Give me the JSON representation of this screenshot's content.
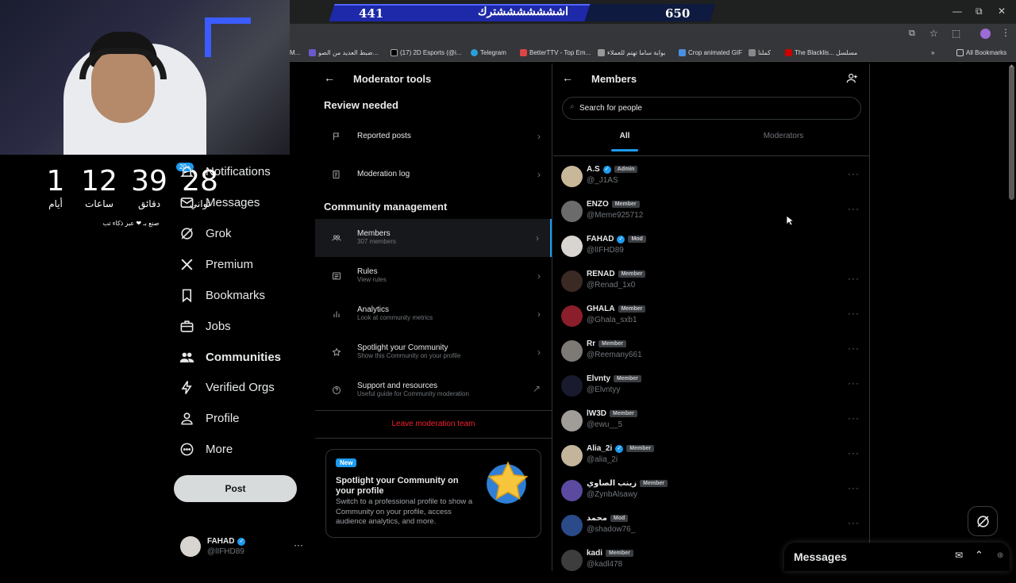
{
  "stream": {
    "ticker_left": "441",
    "ticker_text": "اشششششششترك",
    "ticker_right": "650",
    "countdown": [
      {
        "value": "1",
        "label": "أيام"
      },
      {
        "value": "12",
        "label": "ساعات"
      },
      {
        "value": "39",
        "label": "دقائق"
      },
      {
        "value": "28",
        "label": "ثواني"
      }
    ],
    "countdown_sub": "صنع بـ ❤ عبر ذكاء تب"
  },
  "bookmarks": [
    "M...",
    "ضبط العديد من الصو...",
    "(17) 2D Esports (@i...",
    "Telegram",
    "BetterTTV - Top Em...",
    "بوابة ساما تهتم للعملاء",
    "Crop animated GIF",
    "كملنا",
    "The Blacklis... مسلسل",
    "All Bookmarks"
  ],
  "nav": {
    "badge": "20+",
    "items": [
      {
        "label": "Notifications",
        "icon": "bell-icon"
      },
      {
        "label": "Messages",
        "icon": "envelope-icon"
      },
      {
        "label": "Grok",
        "icon": "grok-icon"
      },
      {
        "label": "Premium",
        "icon": "x-logo-icon"
      },
      {
        "label": "Bookmarks",
        "icon": "bookmark-icon"
      },
      {
        "label": "Jobs",
        "icon": "briefcase-icon"
      },
      {
        "label": "Communities",
        "icon": "people-icon"
      },
      {
        "label": "Verified Orgs",
        "icon": "lightning-icon"
      },
      {
        "label": "Profile",
        "icon": "person-icon"
      },
      {
        "label": "More",
        "icon": "more-circle-icon"
      }
    ],
    "post_label": "Post",
    "profile_name": "FAHAD",
    "profile_handle": "@lIFHD89"
  },
  "moderator": {
    "title": "Moderator tools",
    "review_heading": "Review needed",
    "review_items": [
      {
        "title": "Reported posts",
        "sub": ""
      },
      {
        "title": "Moderation log",
        "sub": ""
      }
    ],
    "management_heading": "Community management",
    "management_items": [
      {
        "title": "Members",
        "sub": "307 members"
      },
      {
        "title": "Rules",
        "sub": "View rules"
      },
      {
        "title": "Analytics",
        "sub": "Look at community metrics"
      },
      {
        "title": "Spotlight your Community",
        "sub": "Show this Community on your profile"
      },
      {
        "title": "Support and resources",
        "sub": "Useful guide for Community moderation"
      }
    ],
    "leave_label": "Leave moderation team",
    "promo": {
      "badge": "New",
      "title": "Spotlight your Community on your profile",
      "body": "Switch to a professional profile to show a Community on your profile, access audience analytics, and more."
    }
  },
  "members": {
    "title": "Members",
    "search_placeholder": "Search for people",
    "tabs": [
      "All",
      "Moderators"
    ],
    "list": [
      {
        "name": "A.S",
        "handle": "@_J1AS",
        "role": "Admin",
        "verified": true,
        "color": "#c9b79a"
      },
      {
        "name": "ENZO",
        "handle": "@Meme925712",
        "role": "Member",
        "verified": false,
        "color": "#6b6b6b"
      },
      {
        "name": "FAHAD",
        "handle": "@lIFHD89",
        "role": "Mod",
        "verified": true,
        "color": "#d8d4cf"
      },
      {
        "name": "RENAD",
        "handle": "@Renad_1x0",
        "role": "Member",
        "verified": false,
        "color": "#3b2a24"
      },
      {
        "name": "GHALA",
        "handle": "@Ghala_sxb1",
        "role": "Member",
        "verified": false,
        "color": "#8a1e2a"
      },
      {
        "name": "Rr",
        "handle": "@Reemany661",
        "role": "Member",
        "verified": false,
        "color": "#7d7a76"
      },
      {
        "name": "Elvnty",
        "handle": "@Elvntyy",
        "role": "Member",
        "verified": false,
        "color": "#1a1a2e"
      },
      {
        "name": "lW3D",
        "handle": "@ewu__5",
        "role": "Member",
        "verified": false,
        "color": "#a09c98"
      },
      {
        "name": "Alia_2i",
        "handle": "@alia_2i",
        "role": "Member",
        "verified": true,
        "color": "#c2b59c"
      },
      {
        "name": "زينب الصاوي",
        "handle": "@ZynbAlsawy",
        "role": "Member",
        "verified": false,
        "color": "#5b4aa0"
      },
      {
        "name": "محمد",
        "handle": "@shadow76_",
        "role": "Mod",
        "verified": false,
        "color": "#2b4a8a"
      },
      {
        "name": "kadi",
        "handle": "@kadl478",
        "role": "Member",
        "verified": false,
        "color": "#3d3d3d"
      }
    ]
  },
  "messages_drawer": {
    "title": "Messages"
  }
}
